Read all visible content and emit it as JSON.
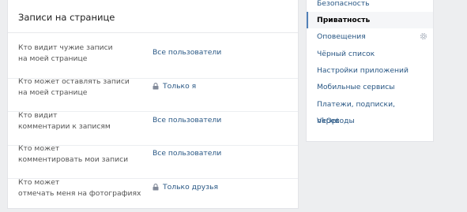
{
  "section": {
    "title": "Записи на странице"
  },
  "rows": [
    {
      "label_line1": "Кто видит чужие записи",
      "label_line2": "на моей странице",
      "value": "Все пользователи",
      "locked": false
    },
    {
      "label_line1": "Кто может оставлять записи",
      "label_line2": "на моей странице",
      "value": "Только я",
      "locked": true
    },
    {
      "label_line1": "Кто видит",
      "label_line2": "комментарии к записям",
      "value": "Все пользователи",
      "locked": false
    },
    {
      "label_line1": "Кто может",
      "label_line2": "комментировать мои записи",
      "value": "Все пользователи",
      "locked": false
    },
    {
      "label_line1": "Кто может",
      "label_line2": "отмечать меня на фотографиях",
      "value": "Только друзья",
      "locked": true
    }
  ],
  "sidebar": {
    "items": [
      {
        "label": "Безопасность"
      },
      {
        "label": "Приватность",
        "active": true
      },
      {
        "label": "Оповещения"
      },
      {
        "label": "Чёрный список"
      },
      {
        "label": "Настройки приложений"
      },
      {
        "label": "Мобильные сервисы"
      },
      {
        "label": "Платежи, подписки, переводы"
      },
      {
        "label": "VkOpt"
      }
    ]
  },
  "colors": {
    "link": "#2a5885",
    "active_marker": "#5181b8",
    "background": "#edeef0"
  }
}
